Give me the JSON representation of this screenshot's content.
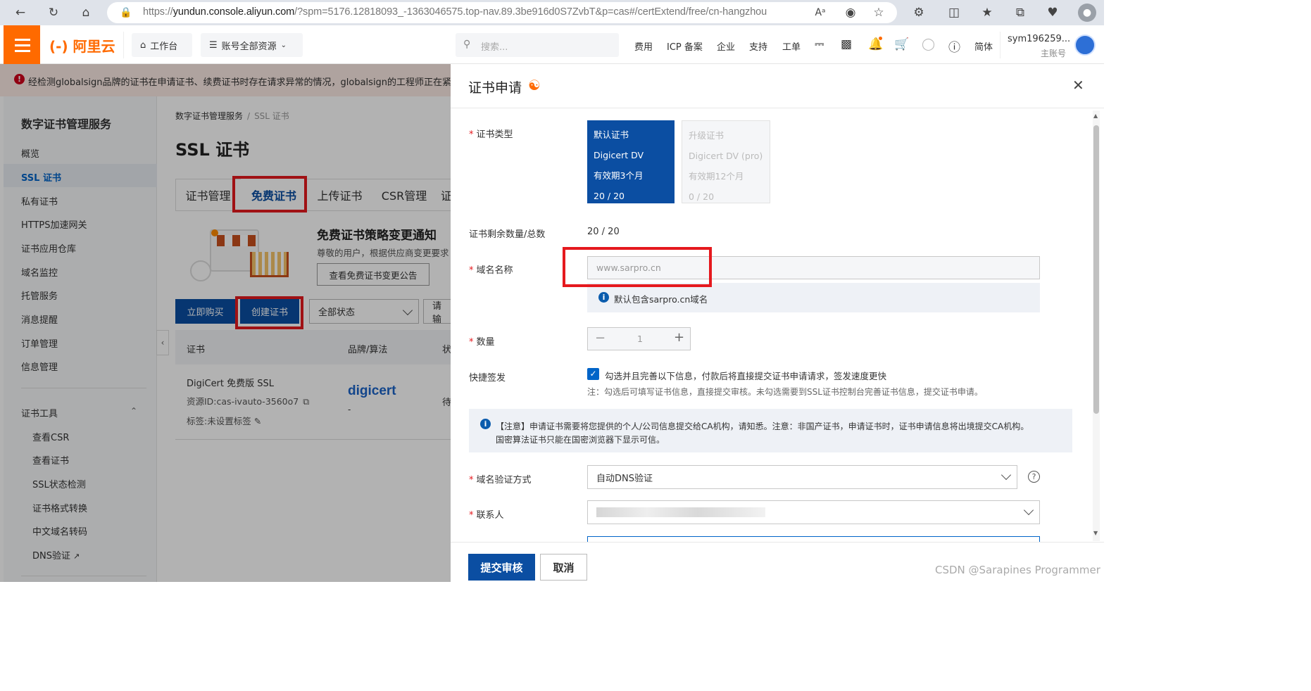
{
  "browser": {
    "url_prefix": "https://",
    "url_domain": "yundun.console.aliyun.com",
    "url_rest": "/?spm=5176.12818093_-1363046575.top-nav.89.3be916d0S7ZvbT&p=cas#/certExtend/free/cn-hangzhou"
  },
  "topnav": {
    "logo": "(-) 阿里云",
    "workbench": "工作台",
    "resources": "账号全部资源",
    "search_placeholder": "搜索...",
    "links": [
      "费用",
      "ICP 备案",
      "企业",
      "支持",
      "工单"
    ],
    "lang": "简体",
    "user": "sym196259...",
    "user_role": "主账号"
  },
  "notice": "经检测globalsign品牌的证书在申请证书、续费证书时存在请求异常的情况，globalsign的工程师正在紧急排查",
  "sidebar": {
    "title": "数字证书管理服务",
    "items": [
      "概览",
      "SSL 证书",
      "私有证书",
      "HTTPS加速网关",
      "证书应用仓库",
      "域名监控",
      "托管服务",
      "消息提醒",
      "订单管理",
      "信息管理"
    ],
    "tools_title": "证书工具",
    "tools": [
      "查看CSR",
      "查看证书",
      "SSL状态检测",
      "证书格式转换",
      "中文域名转码",
      "DNS验证"
    ]
  },
  "main": {
    "breadcrumb": [
      "数字证书管理服务",
      "SSL 证书"
    ],
    "title": "SSL 证书",
    "tabs": [
      "证书管理",
      "免费证书",
      "上传证书",
      "CSR管理",
      "证"
    ],
    "promo_title": "免费证书策略变更通知",
    "promo_text": "尊敬的用户，根据供应商变更要求",
    "promo_button": "查看免费证书变更公告",
    "buy_button": "立即购买",
    "create_button": "创建证书",
    "status_filter": "全部状态",
    "filter2": "请输",
    "table_headers": [
      "证书",
      "品牌/算法",
      "状"
    ],
    "row": {
      "name": "DigiCert 免费版 SSL",
      "id": "资源ID:cas-ivauto-3560o7",
      "tag": "标签:未设置标签",
      "brand": "digicert",
      "algo": "-",
      "status": "待"
    }
  },
  "drawer": {
    "title": "证书申请",
    "labels": {
      "type": "证书类型",
      "remaining": "证书剩余数量/总数",
      "domain": "域名名称",
      "quantity": "数量",
      "quick": "快捷签发",
      "verify": "域名验证方式",
      "contact": "联系人"
    },
    "cards": [
      {
        "lines": [
          "默认证书",
          "Digicert DV",
          "有效期3个月",
          "20 / 20"
        ]
      },
      {
        "lines": [
          "升级证书",
          "Digicert DV (pro)",
          "有效期12个月",
          "0 / 20"
        ]
      }
    ],
    "remaining": "20 / 20",
    "domain_placeholder": "www.sarpro.cn",
    "domain_hint": "默认包含sarpro.cn域名",
    "quantity": "1",
    "quick_check_label": "勾选并且完善以下信息，付款后将直接提交证书申请请求，签发速度更快",
    "quick_note": "注：勾选后可填写证书信息，直接提交审核。未勾选需要到SSL证书控制台完善证书信息，提交证书申请。",
    "alert_line1": "【注意】申请证书需要将您提供的个人/公司信息提交给CA机构，请知悉。注意：非国产证书，申请证书时，证书申请信息将出境提交CA机构。",
    "alert_line2": "国密算法证书只能在国密浏览器下显示可信。",
    "verify_value": "自动DNS验证",
    "submit": "提交审核",
    "cancel": "取消"
  },
  "watermark": "CSDN @Sarapines Programmer",
  "colors": {
    "accent": "#ff6a00",
    "primary": "#0b4ea2",
    "red_box": "#e5191e",
    "check": "#0064c8"
  }
}
